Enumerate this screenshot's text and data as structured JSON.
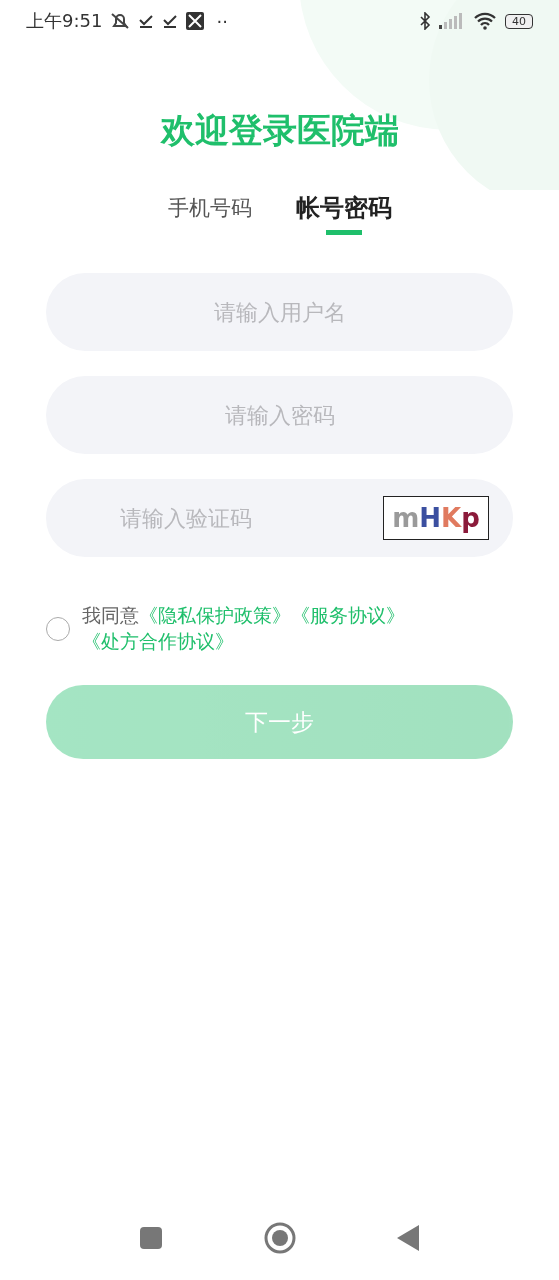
{
  "status_bar": {
    "time": "上午9:51",
    "more": "··",
    "battery": "40"
  },
  "title": "欢迎登录医院端",
  "tabs": [
    {
      "label": "手机号码",
      "selected": false
    },
    {
      "label": "帐号密码",
      "selected": true
    }
  ],
  "fields": [
    {
      "placeholder": "请输入用户名",
      "kind": "text"
    },
    {
      "placeholder": "请输入密码",
      "kind": "text"
    },
    {
      "placeholder": "请输入验证码",
      "kind": "captcha",
      "captcha": "mHKp"
    }
  ],
  "agreement": {
    "checked": false,
    "prefix": "我同意",
    "links": [
      "《隐私保护政策》",
      "《服务协议》",
      "《处方合作协议》"
    ]
  },
  "next_button": {
    "label": "下一步",
    "disabled": true
  }
}
